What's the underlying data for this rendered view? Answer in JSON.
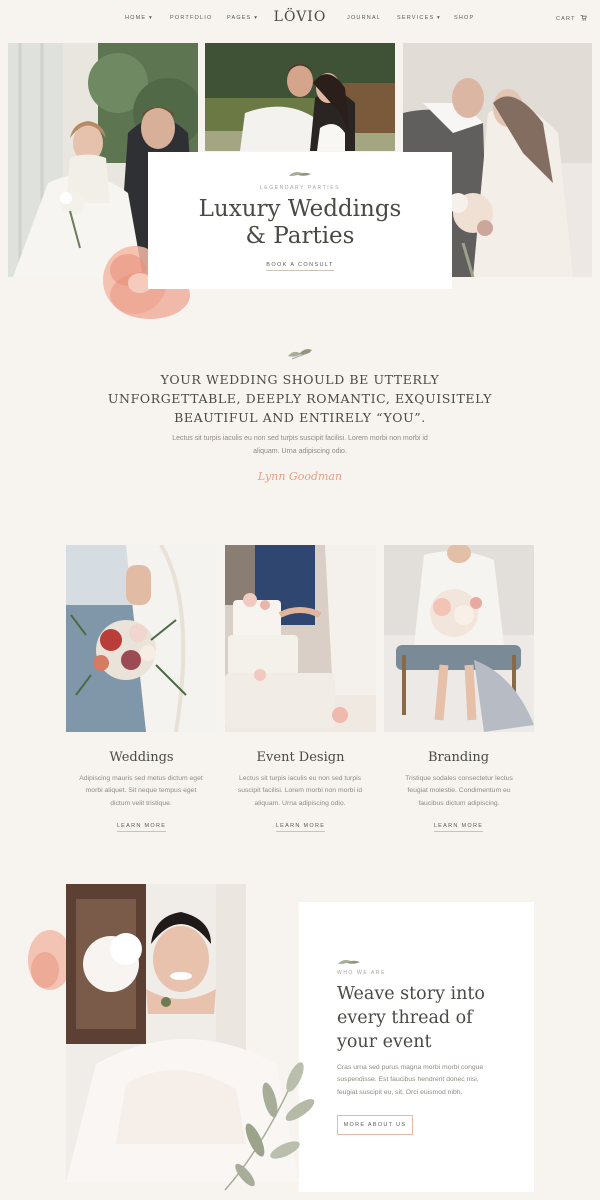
{
  "header": {
    "logo": "LÖVIO",
    "nav_left": [
      "HOME ▾",
      "PORTFOLIO",
      "PAGES ▾"
    ],
    "nav_right": [
      "JOURNAL",
      "SERVICES ▾",
      "SHOP"
    ],
    "cart_label": "CART"
  },
  "hero": {
    "kicker": "LEGENDARY PARTIES",
    "title_line1": "Luxury Weddings",
    "title_line2": "& Parties",
    "cta": "BOOK A CONSULT"
  },
  "quote": {
    "line1": "YOUR WEDDING SHOULD BE UTTERLY",
    "line2": "UNFORGETTABLE, DEEPLY ROMANTIC, EXQUISITELY",
    "line3": "BEAUTIFUL AND ENTIRELY “YOU”.",
    "body_line1": "Lectus sit turpis iaculis eu non sed turpis suscipit facilisi. Lorem morbi non morbi id",
    "body_line2": "aliquam. Urna adipiscing odio.",
    "signature": "Lynn Goodman"
  },
  "services": [
    {
      "title": "Weddings",
      "text_line1": "Adipiscing mauris sed metus dictum eget",
      "text_line2": "morbi aliquet. Sit neque tempus eget",
      "text_line3": "dictum velit tristique.",
      "link": "LEARN MORE"
    },
    {
      "title": "Event Design",
      "text_line1": "Lectus sit turpis iaculis eu non sed turpis",
      "text_line2": "suscipit facilisi. Lorem morbi non morbi id",
      "text_line3": "aliquam. Urna adipiscing odio.",
      "link": "LEARN MORE"
    },
    {
      "title": "Branding",
      "text_line1": "Tristique sodales consectetur lectus",
      "text_line2": "feugiat molestie. Condimentum eu",
      "text_line3": "faucibus dictum adipiscing.",
      "link": "LEARN MORE"
    }
  ],
  "about": {
    "kicker": "WHO WE ARE",
    "title_line1": "Weave story into",
    "title_line2": "every thread of",
    "title_line3": "your event",
    "text_line1": "Cras urna sed purus magna morbi morbi congue",
    "text_line2": "suspendisse. Est faucibus hendrerit donec nisi,",
    "text_line3": "feugiat suscipit eu, sit. Orci euismod nibh.",
    "button": "MORE ABOUT US"
  },
  "colors": {
    "background": "#f7f3ee",
    "accent": "#e0a189",
    "text": "#4a4a45",
    "leaf": "#a7ad98"
  },
  "icons": [
    "leaf-icon",
    "cart-icon"
  ]
}
